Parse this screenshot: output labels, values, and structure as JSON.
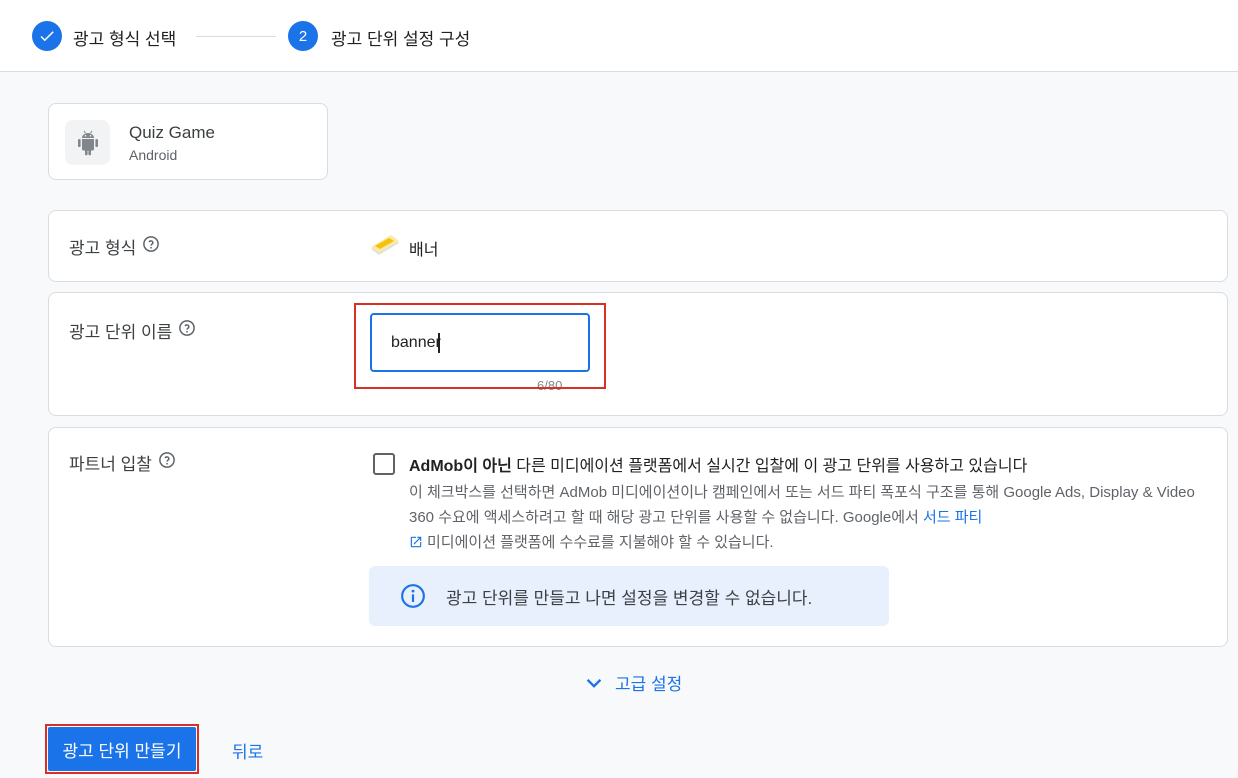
{
  "stepper": {
    "step1": {
      "label": "광고 형식 선택",
      "status": "completed"
    },
    "step2": {
      "number": "2",
      "label": "광고 단위 설정 구성",
      "status": "active"
    }
  },
  "app": {
    "name": "Quiz Game",
    "platform": "Android",
    "icon": "android-icon"
  },
  "ad_format": {
    "label": "광고 형식",
    "value": "배너",
    "icon": "banner-icon"
  },
  "ad_unit_name": {
    "label": "광고 단위 이름",
    "value": "banner",
    "char_count": "6/80"
  },
  "partner_bidding": {
    "label": "파트너 입찰",
    "checkbox_bold": "AdMob이 아닌",
    "checkbox_rest": " 다른 미디에이션 플랫폼에서 실시간 입찰에 이 광고 단위를 사용하고 있습니다",
    "description": "이 체크박스를 선택하면 AdMob 미디에이션이나 캠페인에서 또는 서드 파티 폭포식 구조를 통해 Google Ads, Display & Video 360 수요에 액세스하려고 할 때 해당 광고 단위를 사용할 수 없습니다. Google에서 ",
    "link_text": "서드 파티",
    "description_tail": "미디에이션 플랫폼에 수수료를 지불해야 할 수 있습니다.",
    "checked": false,
    "info_text": "광고 단위를 만들고 나면 설정을 변경할 수 없습니다."
  },
  "advanced_settings": {
    "label": "고급 설정"
  },
  "actions": {
    "create_label": "광고 단위 만들기",
    "back_label": "뒤로"
  },
  "colors": {
    "accent": "#1a73e8",
    "highlight": "#d93025",
    "info_bg": "#e8f0fe"
  }
}
